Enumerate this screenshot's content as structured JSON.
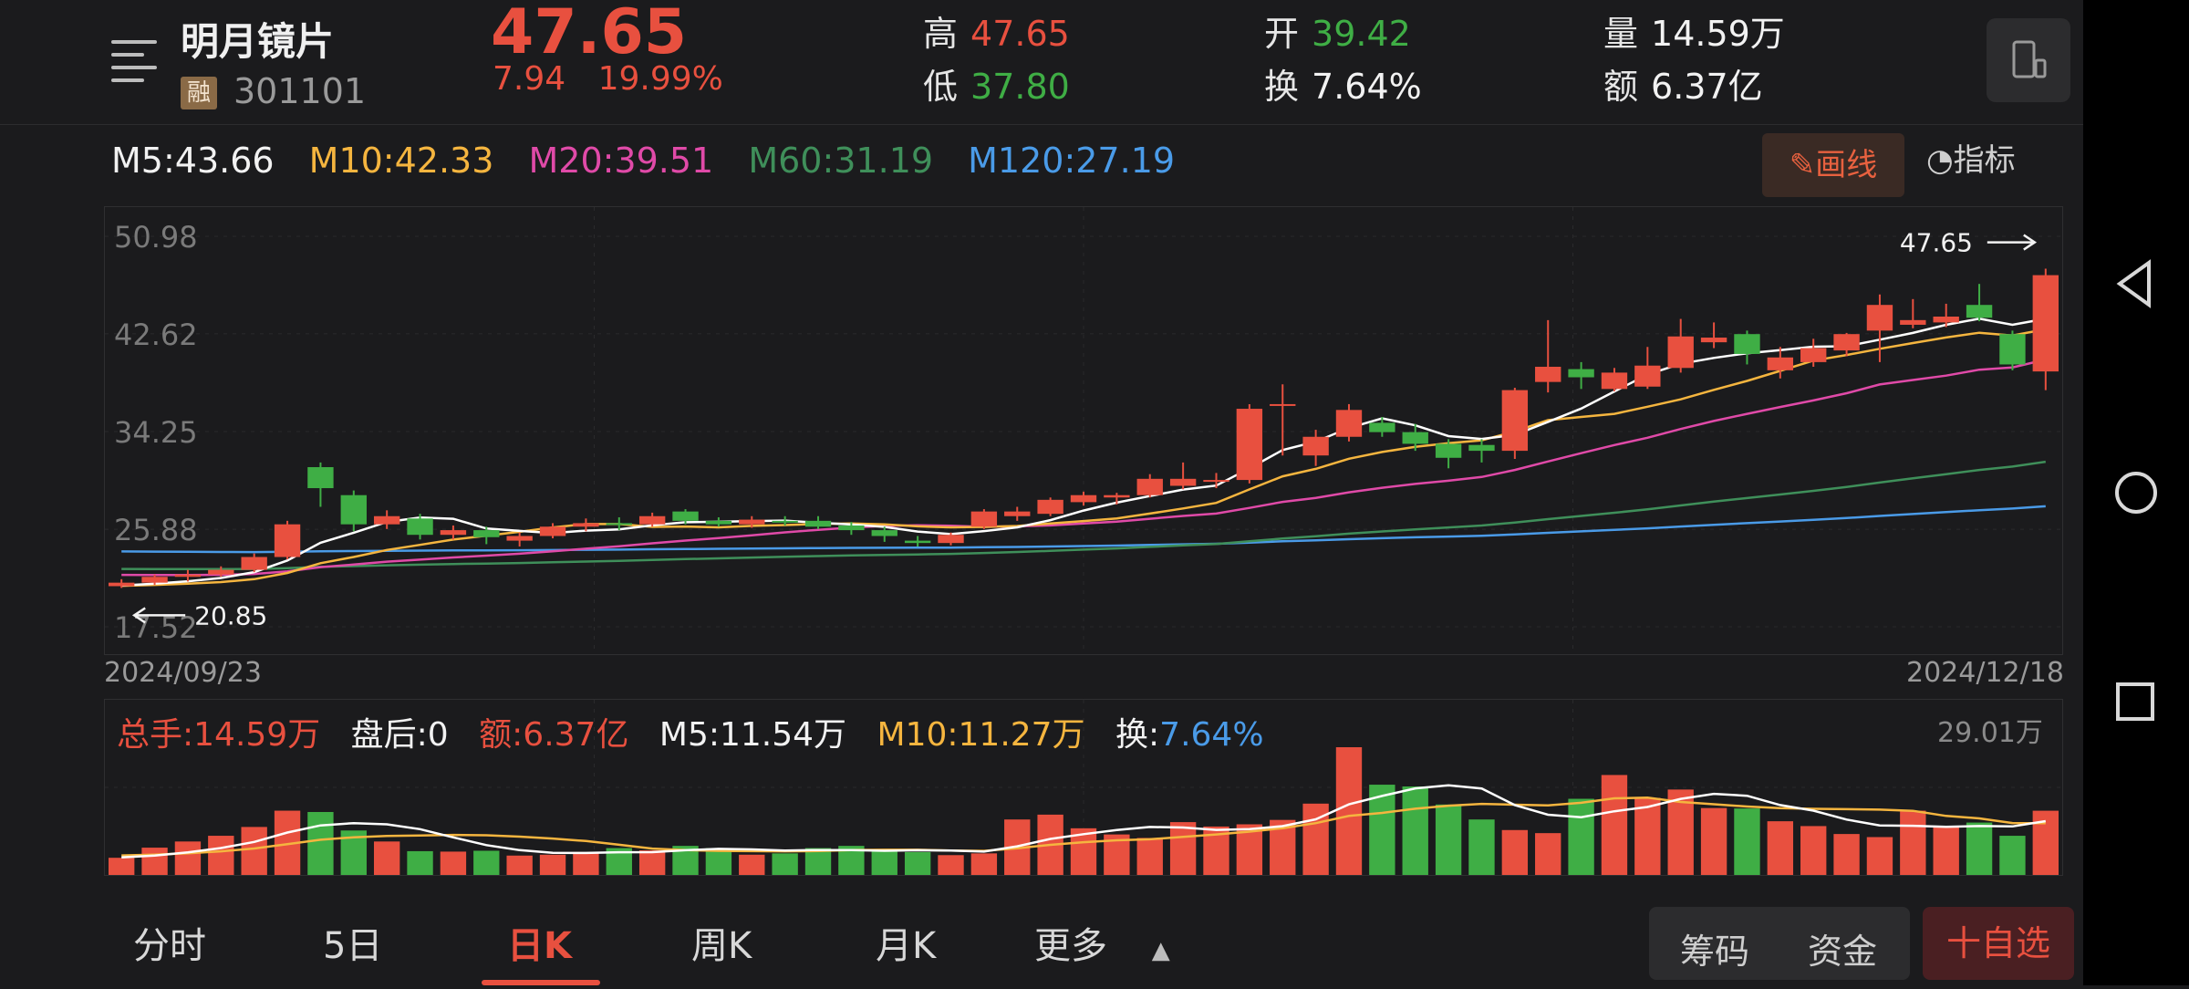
{
  "stock": {
    "name": "明月镜片",
    "margin_badge": "融",
    "code": "301101",
    "price": "47.65",
    "change": "7.94",
    "change_pct": "19.99%",
    "high_label": "高",
    "high": "47.65",
    "low_label": "低",
    "low": "37.80",
    "open_label": "开",
    "open": "39.42",
    "turnover_label": "换",
    "turnover": "7.64%",
    "volume_label": "量",
    "volume": "14.59万",
    "amount_label": "额",
    "amount": "6.37亿"
  },
  "ma": {
    "m5": "M5:43.66",
    "m10": "M10:42.33",
    "m20": "M20:39.51",
    "m60": "M60:31.19",
    "m120": "M120:27.19"
  },
  "toolbar": {
    "draw_label": "画线",
    "index_label": "指标"
  },
  "colors": {
    "up": "#e8503f",
    "down": "#3fae45",
    "m5": "#ffffff",
    "m10": "#f5b53f",
    "m20": "#e04aa8",
    "m60": "#3f8f5a",
    "m120": "#4a9be8"
  },
  "chart_data": {
    "type": "candlestick",
    "y_ticks": [
      "50.98",
      "42.62",
      "34.25",
      "25.88",
      "17.52"
    ],
    "ylim": [
      17.52,
      50.98
    ],
    "start_date": "2024/09/23",
    "end_date": "2024/12/18",
    "max_label": "47.65",
    "min_label": "20.85",
    "candles": [
      [
        21.0,
        21.6,
        20.85,
        21.3
      ],
      [
        21.3,
        22.0,
        21.1,
        21.8
      ],
      [
        21.8,
        22.4,
        21.4,
        22.0
      ],
      [
        22.0,
        22.7,
        21.8,
        22.4
      ],
      [
        22.4,
        23.8,
        22.2,
        23.5
      ],
      [
        23.5,
        26.6,
        23.3,
        26.3
      ],
      [
        31.2,
        31.6,
        27.8,
        29.4
      ],
      [
        28.8,
        29.2,
        25.7,
        26.3
      ],
      [
        26.3,
        27.5,
        25.9,
        27.0
      ],
      [
        26.8,
        27.2,
        25.0,
        25.4
      ],
      [
        25.4,
        26.2,
        25.0,
        25.8
      ],
      [
        25.8,
        26.1,
        24.6,
        25.2
      ],
      [
        24.9,
        25.6,
        24.4,
        25.3
      ],
      [
        25.3,
        26.4,
        25.1,
        26.1
      ],
      [
        26.1,
        26.8,
        25.7,
        26.4
      ],
      [
        26.4,
        26.9,
        25.8,
        26.3
      ],
      [
        26.3,
        27.3,
        26.1,
        27.0
      ],
      [
        27.4,
        27.6,
        26.3,
        26.6
      ],
      [
        26.6,
        26.9,
        26.1,
        26.3
      ],
      [
        26.3,
        27.0,
        26.0,
        26.7
      ],
      [
        26.6,
        27.0,
        26.2,
        26.5
      ],
      [
        26.6,
        27.0,
        25.9,
        26.1
      ],
      [
        26.2,
        26.5,
        25.4,
        25.8
      ],
      [
        25.8,
        26.1,
        24.8,
        25.3
      ],
      [
        24.9,
        25.3,
        24.4,
        24.7
      ],
      [
        24.7,
        25.6,
        24.5,
        25.4
      ],
      [
        26.1,
        27.6,
        25.9,
        27.4
      ],
      [
        27.0,
        27.8,
        26.6,
        27.4
      ],
      [
        27.2,
        28.6,
        27.0,
        28.4
      ],
      [
        28.2,
        29.1,
        27.9,
        28.8
      ],
      [
        28.6,
        29.0,
        28.0,
        28.8
      ],
      [
        28.8,
        30.6,
        28.6,
        30.2
      ],
      [
        29.6,
        31.6,
        29.3,
        30.2
      ],
      [
        30.0,
        30.7,
        29.4,
        30.1
      ],
      [
        30.1,
        36.6,
        29.8,
        36.2
      ],
      [
        36.6,
        38.3,
        32.2,
        36.6
      ],
      [
        32.2,
        34.4,
        31.3,
        33.8
      ],
      [
        33.8,
        36.6,
        33.4,
        36.1
      ],
      [
        35.0,
        35.5,
        33.8,
        34.2
      ],
      [
        34.2,
        34.9,
        32.6,
        33.2
      ],
      [
        33.2,
        33.6,
        31.1,
        32.0
      ],
      [
        33.1,
        33.6,
        31.6,
        32.6
      ],
      [
        32.6,
        38.0,
        31.9,
        37.8
      ],
      [
        38.5,
        43.8,
        37.6,
        39.8
      ],
      [
        39.6,
        40.2,
        37.9,
        38.9
      ],
      [
        37.9,
        39.7,
        37.7,
        39.3
      ],
      [
        38.1,
        41.5,
        37.9,
        39.9
      ],
      [
        39.7,
        43.9,
        39.3,
        42.4
      ],
      [
        41.9,
        43.6,
        41.4,
        42.3
      ],
      [
        42.6,
        42.9,
        40.0,
        40.9
      ],
      [
        39.5,
        41.5,
        38.8,
        40.6
      ],
      [
        40.2,
        42.2,
        39.8,
        41.4
      ],
      [
        41.2,
        42.7,
        40.7,
        42.6
      ],
      [
        42.9,
        46.0,
        40.2,
        45.1
      ],
      [
        43.4,
        45.6,
        43.1,
        43.8
      ],
      [
        43.6,
        45.2,
        43.2,
        44.1
      ],
      [
        45.1,
        46.9,
        43.7,
        44.0
      ],
      [
        42.6,
        42.9,
        39.5,
        40.0
      ],
      [
        39.4,
        48.2,
        37.8,
        47.65
      ]
    ],
    "volume": {
      "total_label": "总手:14.59万",
      "after_hours_label": "盘后:0",
      "amount_label": "额:6.37亿",
      "m5_label": "M5:11.54万",
      "m10_label": "M10:11.27万",
      "turnover_label": "换:",
      "turnover_value": "7.64%",
      "max_label": "29.01万",
      "ylim": [
        0,
        29.01
      ],
      "values": [
        3.9,
        6.2,
        7.6,
        8.9,
        10.9,
        14.6,
        14.3,
        10.1,
        7.6,
        5.4,
        5.3,
        5.5,
        4.4,
        4.6,
        5.2,
        6.1,
        5.6,
        6.6,
        6.1,
        4.6,
        4.9,
        6.1,
        6.6,
        5.3,
        5.2,
        4.5,
        4.9,
        12.6,
        13.7,
        10.6,
        9.2,
        8.4,
        12.0,
        11.0,
        11.5,
        12.5,
        16.2,
        29.01,
        20.5,
        20.1,
        16.0,
        12.6,
        10.2,
        9.5,
        17.3,
        22.7,
        17.5,
        19.4,
        15.2,
        15.1,
        12.2,
        11.1,
        9.3,
        8.6,
        14.6,
        11.1,
        11.9,
        8.9,
        14.59
      ]
    }
  },
  "tabs": [
    "分时",
    "5日",
    "日K",
    "周K",
    "月K",
    "更多"
  ],
  "active_tab": "日K",
  "actions": {
    "chips_label": "筹码",
    "capital_label": "资金",
    "add_watch_label": "十自选"
  }
}
